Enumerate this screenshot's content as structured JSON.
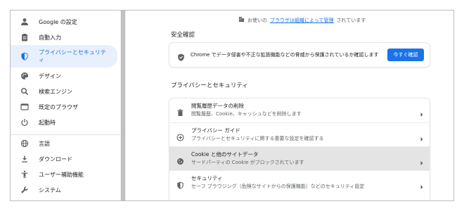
{
  "sidebar": {
    "items": [
      {
        "label": "Google の設定",
        "icon": "person-icon"
      },
      {
        "label": "自動入力",
        "icon": "clipboard-icon"
      },
      {
        "label": "プライバシーとセキュリティ",
        "icon": "shield-icon",
        "active": true
      },
      {
        "label": "デザイン",
        "icon": "palette-icon"
      },
      {
        "label": "検索エンジン",
        "icon": "search-icon"
      },
      {
        "label": "既定のブラウザ",
        "icon": "browser-icon"
      },
      {
        "label": "起動時",
        "icon": "power-icon"
      },
      {
        "label": "言語",
        "icon": "globe-icon"
      },
      {
        "label": "ダウンロード",
        "icon": "download-icon"
      },
      {
        "label": "ユーザー補助機能",
        "icon": "accessibility-icon"
      },
      {
        "label": "システム",
        "icon": "wrench-icon"
      }
    ]
  },
  "managed_note": {
    "prefix": "お使いの",
    "link1": "ブラウザは組織によって管理",
    "suffix": "されています"
  },
  "safety_check": {
    "title": "安全確認",
    "text": "Chrome でデータ侵害や不正な拡張機能などの脅威から保護されているか確認します",
    "button": "今すぐ確認"
  },
  "privacy": {
    "title": "プライバシーとセキュリティ",
    "rows": [
      {
        "title": "閲覧履歴データの削除",
        "sub": "閲覧履歴、Cookie、キャッシュなどを削除します",
        "icon": "trash-icon"
      },
      {
        "title": "プライバシー ガイド",
        "sub": "プライバシーとセキュリティに関する重要な設定を確認する",
        "icon": "add-circle-icon"
      },
      {
        "title": "Cookie と他のサイトデータ",
        "sub": "サードパーティの Cookie がブロックされています",
        "icon": "cookie-icon",
        "highlight": true
      },
      {
        "title": "セキュリティ",
        "sub": "セーフ ブラウジング（危険なサイトからの保護機能）などのセキュリティ設定",
        "icon": "shield-icon"
      }
    ]
  },
  "colors": {
    "accent": "#1a73e8",
    "active_bg": "#e8f0fe",
    "highlight_row": "#e4e4e4"
  }
}
